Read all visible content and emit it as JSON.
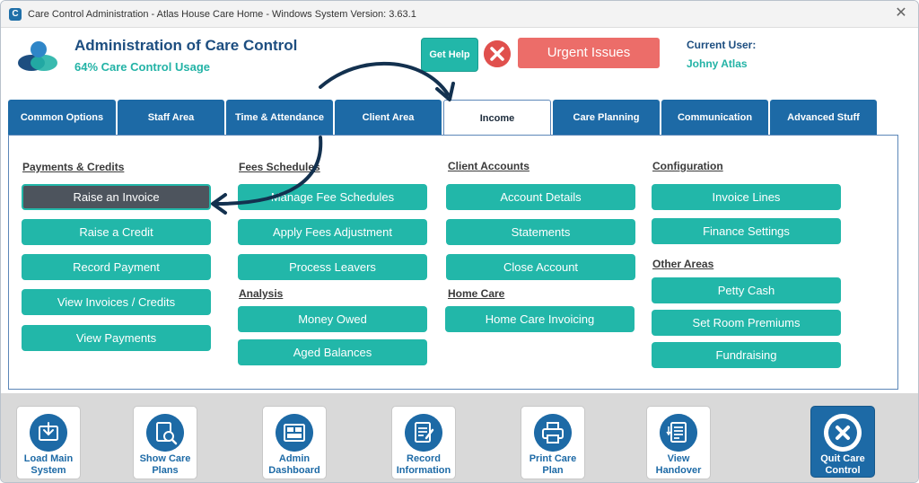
{
  "window": {
    "title": "Care Control Administration - Atlas House Care Home - Windows System Version: 3.63.1"
  },
  "header": {
    "app_title": "Administration of Care Control",
    "usage": "64% Care Control Usage",
    "help_label": "Get Help",
    "urgent_label": "Urgent Issues",
    "user_label": "Current User:",
    "user_name": "Johny Atlas"
  },
  "tabs": [
    {
      "label": "Common Options"
    },
    {
      "label": "Staff Area"
    },
    {
      "label": "Time & Attendance"
    },
    {
      "label": "Client Area"
    },
    {
      "label": "Income",
      "active": true
    },
    {
      "label": "Care Planning"
    },
    {
      "label": "Communication"
    },
    {
      "label": "Advanced Stuff"
    }
  ],
  "sections": {
    "payments": {
      "title": "Payments & Credits",
      "items": [
        "Raise an Invoice",
        "Raise a Credit",
        "Record Payment",
        "View Invoices / Credits",
        "View Payments"
      ]
    },
    "fees": {
      "title": "Fees Schedules",
      "items": [
        "Manage Fee Schedules",
        "Apply Fees Adjustment",
        "Process Leavers"
      ]
    },
    "analysis": {
      "title": "Analysis",
      "items": [
        "Money Owed",
        "Aged Balances"
      ]
    },
    "client_accounts": {
      "title": "Client Accounts",
      "items": [
        "Account Details",
        "Statements",
        "Close Account"
      ]
    },
    "home_care": {
      "title": "Home Care",
      "items": [
        "Home Care Invoicing"
      ]
    },
    "configuration": {
      "title": "Configuration",
      "items": [
        "Invoice Lines",
        "Finance Settings"
      ]
    },
    "other": {
      "title": "Other Areas",
      "items": [
        "Petty Cash",
        "Set Room Premiums",
        "Fundraising"
      ]
    }
  },
  "bottom_bar": [
    {
      "label": "Load Main\nSystem",
      "icon": "load-system-icon"
    },
    {
      "label": "Show Care\nPlans",
      "icon": "care-plans-icon"
    },
    {
      "label": "Admin\nDashboard",
      "icon": "dashboard-icon"
    },
    {
      "label": "Record\nInformation",
      "icon": "record-info-icon"
    },
    {
      "label": "Print Care\nPlan",
      "icon": "printer-icon"
    },
    {
      "label": "View\nHandover",
      "icon": "handover-icon"
    },
    {
      "label": "Quit Care\nControl",
      "icon": "quit-icon"
    }
  ],
  "colors": {
    "primary_blue": "#1d6aa6",
    "teal": "#22b7a9",
    "urgent_red": "#ec6d69",
    "selected_dark": "#4d545d"
  }
}
